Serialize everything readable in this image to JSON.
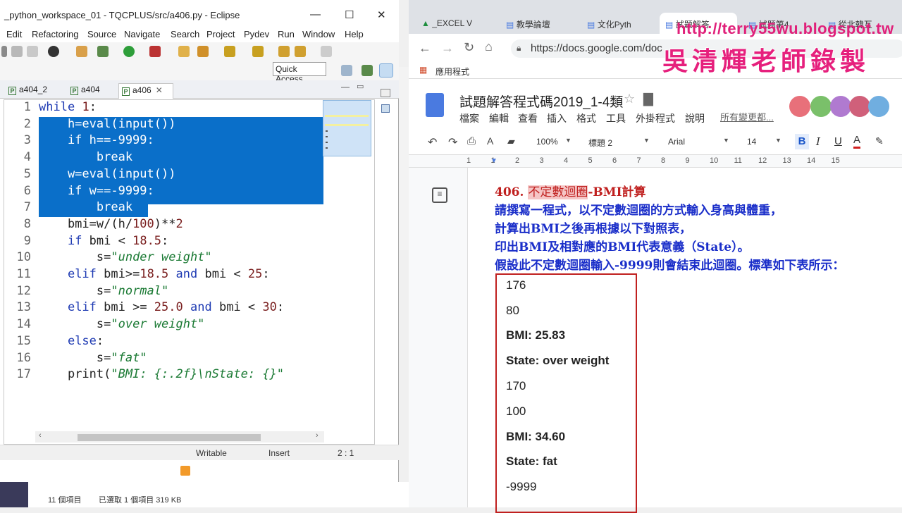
{
  "eclipse": {
    "title": "_python_workspace_01 - TQCPLUS/src/a406.py - Eclipse",
    "window_buttons": [
      "—",
      "☐",
      "✕"
    ],
    "menu": [
      "Edit",
      "Refactoring",
      "Source",
      "Navigate",
      "Search",
      "Project",
      "Pydev",
      "Run",
      "Window",
      "Help"
    ],
    "quick_access": "Quick Access",
    "tabs": [
      "a404_2",
      "a404",
      "a406"
    ],
    "code_lines": [
      "while 1:",
      "    h=eval(input())",
      "    if h==-9999:",
      "        break",
      "    w=eval(input())",
      "    if w==-9999:",
      "        break",
      "    bmi=w/(h/100)**2",
      "    if bmi < 18.5:",
      "        s=\"under weight\"",
      "    elif bmi>=18.5 and bmi < 25:",
      "        s=\"normal\"",
      "    elif bmi >= 25.0 and bmi < 30:",
      "        s=\"over weight\"",
      "    else:",
      "        s=\"fat\"",
      "    print(\"BMI: {:.2f}\\nState: {}\""
    ],
    "status": {
      "writable": "Writable",
      "mode": "Insert",
      "pos": "2 : 1"
    }
  },
  "explorer_status": {
    "count": "11 個項目",
    "selected": "已選取 1 個項目  319 KB"
  },
  "chrome": {
    "tabs": [
      "_EXCEL V",
      "教學論壇",
      "文化Pyth",
      "試題解答",
      "試題第4",
      "從北韓互"
    ],
    "url": "https://docs.google.com/doc",
    "bookmark": "應用程式"
  },
  "gdoc": {
    "title": "試題解答程式碼2019_1-4類",
    "menus": [
      "檔案",
      "編輯",
      "查看",
      "插入",
      "格式",
      "工具",
      "外掛程式",
      "說明"
    ],
    "last_edit": "所有變更都...",
    "zoom": "100%",
    "style": "標題 2",
    "font": "Arial",
    "size": "14",
    "ruler": [
      "1",
      "1",
      "2",
      "3",
      "4",
      "5",
      "6",
      "7",
      "8",
      "9",
      "10",
      "11",
      "12",
      "13",
      "14",
      "15"
    ],
    "heading_num": "406.",
    "heading_hl": "不定數迴圈",
    "heading_rest": "-BMI計算",
    "lines": [
      "請撰寫一程式，以不定數迴圈的方式輸入身高與體重，",
      "計算出BMI之後再根據以下對照表，",
      "印出BMI及相對應的BMI代表意義（State）。",
      "假設此不定數迴圈輸入-9999則會結束此迴圈。標準如下表所示："
    ],
    "box": [
      "176",
      "80",
      "BMI: 25.83",
      "State: over weight",
      "170",
      "100",
      "BMI: 34.60",
      "State: fat",
      "-9999"
    ]
  },
  "watermark": {
    "url": "http://terry55wu.blogspot.tw",
    "name": "吳清輝老師錄製"
  },
  "colors": {
    "selection": "#0a6fc9",
    "keyword": "#1f3bb3",
    "string": "#1b7a34",
    "doc_text": "#1a2ec9",
    "box_border": "#c0201f"
  }
}
